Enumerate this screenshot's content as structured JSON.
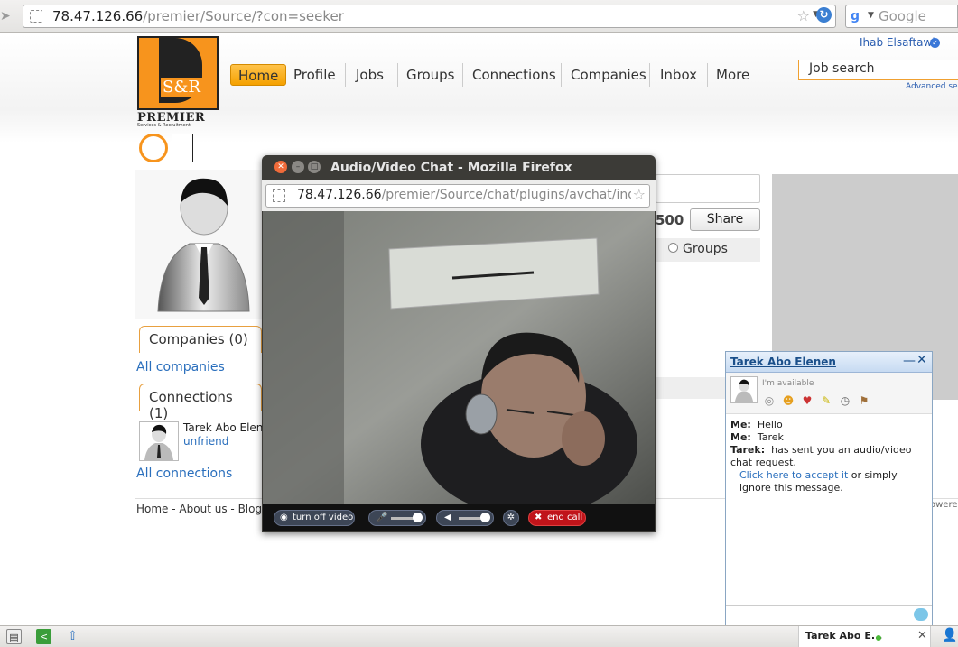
{
  "browser": {
    "url_host": "78.47.126.66",
    "url_path": "/premier/Source/?con=seeker",
    "search_placeholder": "Google"
  },
  "header": {
    "user_name": "Ihab Elsaftawi",
    "logo_letters": "S&R",
    "logo_name": "PREMIER",
    "logo_tagline": "Services & Recruitment",
    "nav": [
      "Home",
      "Profile",
      "Jobs",
      "Groups",
      "Connections",
      "Companies",
      "Inbox",
      "More"
    ],
    "job_search_placeholder": "Job search",
    "advanced_search": "Advanced se"
  },
  "profile": {
    "companies_tab": "Companies (0)",
    "all_companies": "All companies",
    "connections_tab": "Connections (1)",
    "connection_name": "Tarek Abo Elene",
    "unfriend": "unfriend",
    "all_connections": "All connections",
    "char_count": "500",
    "share": "Share",
    "groups_option": "Groups"
  },
  "footer": {
    "links": [
      "Home",
      "About us",
      "Blog"
    ],
    "powered": "owered"
  },
  "popup": {
    "title": "Audio/Video Chat - Mozilla Firefox",
    "url_host": "78.47.126.66",
    "url_path": "/premier/Source/chat/plugins/avchat/inde",
    "controls": {
      "turn_off_video": "turn off video",
      "end_call": "end call"
    }
  },
  "chat": {
    "contact_name": "Tarek Abo Elenen",
    "status": "I'm available",
    "messages": [
      {
        "sender": "Me:",
        "text": "Hello"
      },
      {
        "sender": "Me:",
        "text": "Tarek"
      }
    ],
    "request_sender": "Tarek:",
    "request_text_1": "has sent you an audio/video chat request.",
    "request_link": "Click here to accept it",
    "request_text_2": "or simply ignore this message."
  },
  "statusbar": {
    "chat_tab_name": "Tarek Abo E..."
  }
}
